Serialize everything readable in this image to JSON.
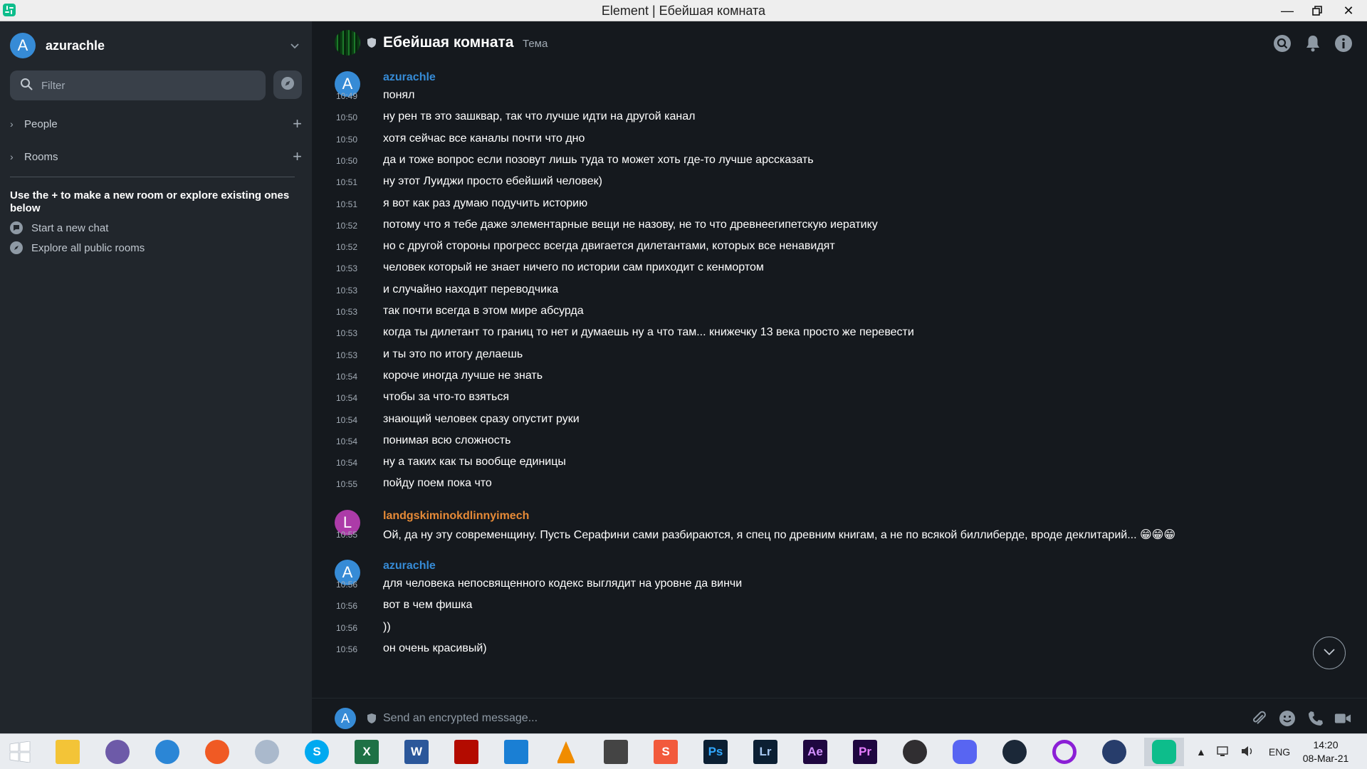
{
  "window": {
    "title": "Element | Ебейшая комната"
  },
  "sidebar": {
    "account_initial": "A",
    "account_name": "azurachle",
    "filter_placeholder": "Filter",
    "sections": [
      {
        "label": "People"
      },
      {
        "label": "Rooms"
      }
    ],
    "hint": "Use the + to make a new room or explore existing ones below",
    "links": [
      {
        "label": "Start a new chat",
        "icon": "chat-bubble-icon"
      },
      {
        "label": "Explore all public rooms",
        "icon": "compass-icon"
      }
    ]
  },
  "room": {
    "name": "Ебейшая комната",
    "topic": "Тема"
  },
  "timeline": {
    "groups": [
      {
        "sender": "azurachle",
        "initial": "A",
        "avatar_color": "#368bd6",
        "name_color": "#368bd6",
        "messages": [
          {
            "time": "10:49",
            "text": "понял"
          },
          {
            "time": "10:50",
            "text": "ну рен тв это зашквар, так что лучше идти на другой канал"
          },
          {
            "time": "10:50",
            "text": "хотя сейчас все каналы почти что дно"
          },
          {
            "time": "10:50",
            "text": "да и тоже вопрос если позовут лишь туда то может хоть где-то лучше арссказать"
          },
          {
            "time": "10:51",
            "text": "ну этот Луиджи просто ебейший человек)"
          },
          {
            "time": "10:51",
            "text": "я вот как раз думаю подучить историю"
          },
          {
            "time": "10:52",
            "text": "потому что я тебе даже элементарные вещи не назову, не то что древнеегипетскую иератику"
          },
          {
            "time": "10:52",
            "text": "но с другой стороны прогресс всегда двигается дилетантами, которых все ненавидят"
          },
          {
            "time": "10:53",
            "text": "человек который не знает ничего по истории сам приходит с кенмортом"
          },
          {
            "time": "10:53",
            "text": "и случайно находит переводчика"
          },
          {
            "time": "10:53",
            "text": "так почти всегда в этом мире абсурда"
          },
          {
            "time": "10:53",
            "text": "когда ты дилетант то границ то нет и думаешь ну а что там... книжечку 13 века просто же перевести"
          },
          {
            "time": "10:53",
            "text": "и ты это по итогу делаешь"
          },
          {
            "time": "10:54",
            "text": "короче иногда лучше не знать"
          },
          {
            "time": "10:54",
            "text": "чтобы за что-то взяться"
          },
          {
            "time": "10:54",
            "text": "знающий человек сразу опустит руки"
          },
          {
            "time": "10:54",
            "text": "понимая всю сложность"
          },
          {
            "time": "10:54",
            "text": "ну а таких как ты вообще единицы"
          },
          {
            "time": "10:55",
            "text": "пойду поем пока что"
          }
        ]
      },
      {
        "sender": "landgskiminokdlinnyimech",
        "initial": "L",
        "avatar_color": "#ac3ba8",
        "name_color": "#e68a37",
        "messages": [
          {
            "time": "10:55",
            "text": "Ой, да ну эту современщину. Пусть Серафини сами разбираются, я спец по древним книгам, а не по всякой биллиберде, вроде деклитарий... 😁😁😁"
          }
        ]
      },
      {
        "sender": "azurachle",
        "initial": "A",
        "avatar_color": "#368bd6",
        "name_color": "#368bd6",
        "messages": [
          {
            "time": "10:56",
            "text": "для человека непосвященного кодекс выглядит на уровне да винчи"
          },
          {
            "time": "10:56",
            "text": "вот в чем фишка"
          },
          {
            "time": "10:56",
            "text": "))"
          },
          {
            "time": "10:56",
            "text": "он очень красивый)"
          }
        ]
      }
    ]
  },
  "composer": {
    "initial": "A",
    "placeholder": "Send an encrypted message..."
  },
  "taskbar": {
    "apps": [
      "windows-start-icon",
      "file-explorer-icon",
      "qbittorrent-icon",
      "browser-globe-icon",
      "firefox-icon",
      "moon-app-icon",
      "skype-icon",
      "excel-icon",
      "word-icon",
      "acrobat-icon",
      "vscode-icon",
      "vlc-icon",
      "downloader-icon",
      "sublime-icon",
      "photoshop-icon",
      "lightroom-icon",
      "after-effects-icon",
      "premiere-icon",
      "obs-icon",
      "discord-icon",
      "steam-icon",
      "cortana-ring-icon",
      "keepass-icon",
      "element-icon"
    ],
    "app_labels": {
      "ps": "Ps",
      "lr": "Lr",
      "ae": "Ae",
      "pr": "Pr",
      "s": "S"
    },
    "lang": "ENG",
    "time": "14:20",
    "date": "08-Mar-21"
  }
}
